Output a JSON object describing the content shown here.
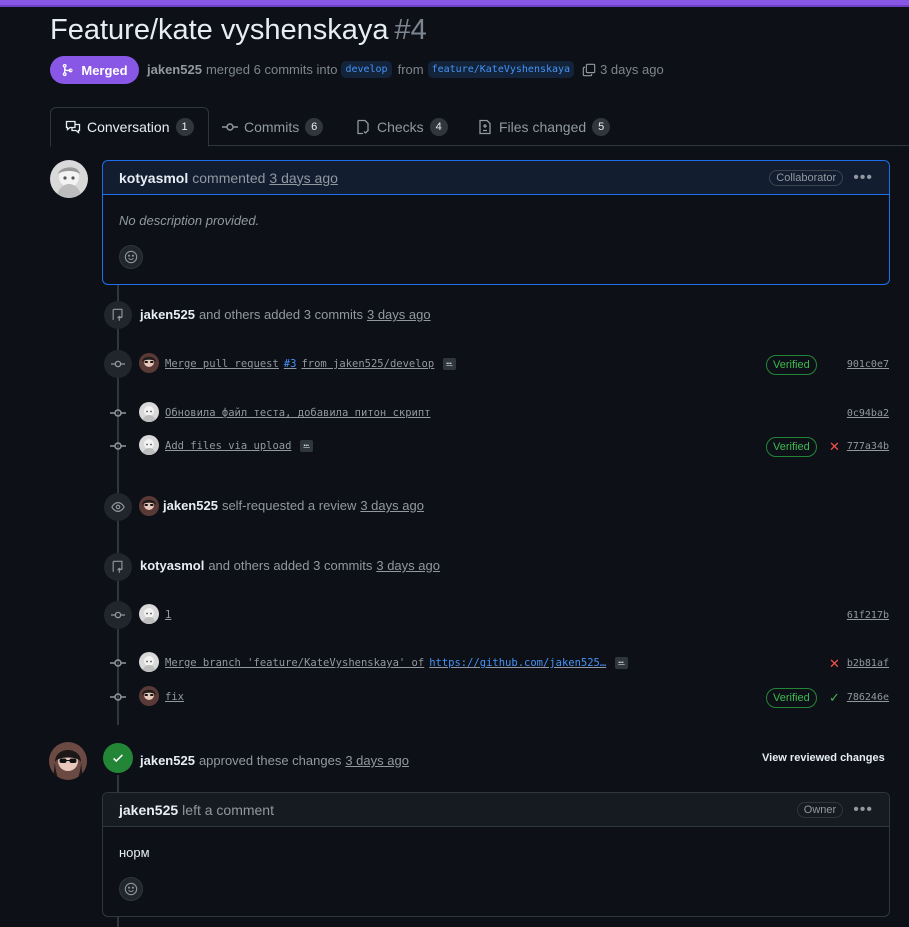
{
  "header": {
    "title": "Feature/kate vyshenskaya",
    "number": "#4",
    "status_label": "Merged",
    "meta_user": "jaken525",
    "meta_text1": "merged 6 commits into",
    "base_branch": "develop",
    "meta_text2": "from",
    "head_branch": "feature/KateVyshenskaya",
    "meta_time": "3 days ago"
  },
  "tabs": [
    {
      "label": "Conversation",
      "count": "1",
      "icon": "comment-discussion-icon"
    },
    {
      "label": "Commits",
      "count": "6",
      "icon": "git-commit-icon"
    },
    {
      "label": "Checks",
      "count": "4",
      "icon": "checklist-icon"
    },
    {
      "label": "Files changed",
      "count": "5",
      "icon": "file-diff-icon"
    }
  ],
  "first_comment": {
    "author": "kotyasmol",
    "action": "commented",
    "time": "3 days ago",
    "role": "Collaborator",
    "body": "No description provided."
  },
  "event1": {
    "user": "jaken525",
    "text": "and others added 3 commits",
    "time": "3 days ago"
  },
  "commits1": [
    {
      "msg_a": "Merge pull request",
      "msg_link": "#3",
      "msg_b": "from jaken525/develop",
      "verified": "Verified",
      "sha": "901c0e7"
    },
    {
      "msg": "Обновила файл теста, добавила питон скрипт",
      "sha": "0c94ba2"
    },
    {
      "msg": "Add files via upload",
      "verified": "Verified",
      "sha": "777a34b"
    }
  ],
  "event2": {
    "user": "jaken525",
    "text": "self-requested a review",
    "time": "3 days ago"
  },
  "event3": {
    "user": "kotyasmol",
    "text": "and others added 3 commits",
    "time": "3 days ago"
  },
  "commits2": [
    {
      "msg": "1",
      "sha": "61f217b"
    },
    {
      "msg_a": "Merge branch 'feature/KateVyshenskaya' of",
      "msg_link": "https://github.com/jaken525…",
      "sha": "b2b81af"
    },
    {
      "msg": "fix",
      "verified": "Verified",
      "sha": "786246e"
    }
  ],
  "review": {
    "user": "jaken525",
    "text": "approved these changes",
    "time": "3 days ago",
    "view_label": "View reviewed changes"
  },
  "review_comment": {
    "author": "jaken525",
    "action": "left a comment",
    "role": "Owner",
    "body": "норм"
  },
  "colors": {
    "merged": "#8957e5",
    "verified": "#3fb950",
    "link": "#4493f8",
    "fail": "#f85149",
    "background": "#0d1117"
  }
}
